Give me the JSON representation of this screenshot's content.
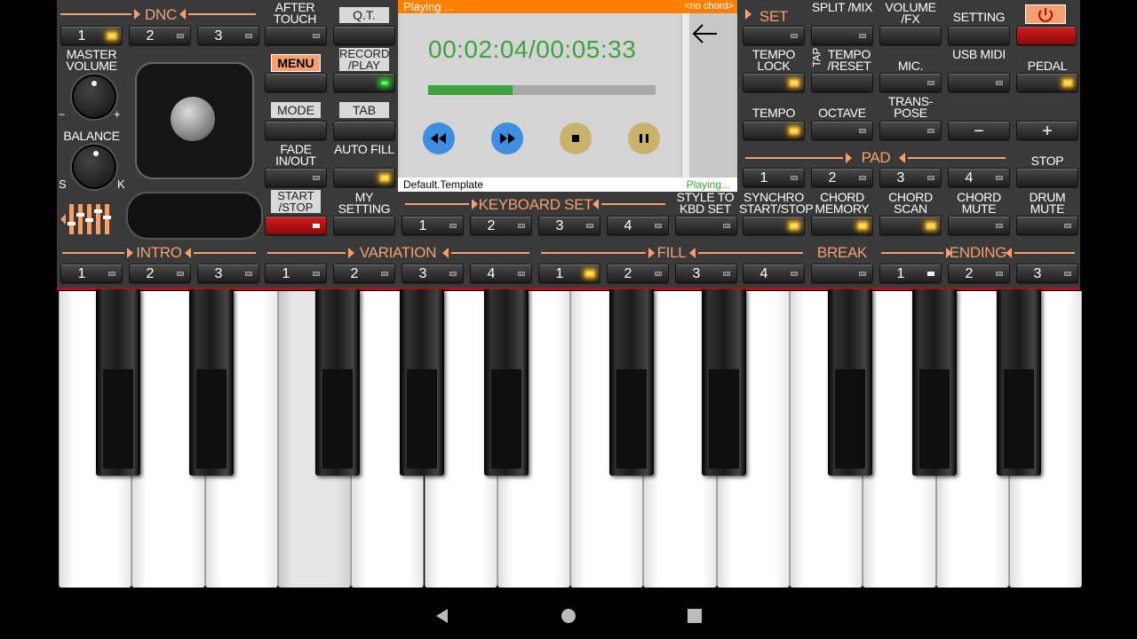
{
  "dnc": {
    "label": "DNC",
    "buttons": [
      "1",
      "2",
      "3"
    ]
  },
  "after_touch": "AFTER TOUCH",
  "qt": "Q.T.",
  "menu": "MENU",
  "record_play": "RECORD /PLAY",
  "mode": "MODE",
  "tab": "TAB",
  "fade": "FADE IN/OUT",
  "auto_fill": "AUTO FILL",
  "start_stop": "START /STOP",
  "my_setting": "MY SETTING",
  "master_volume": "MASTER VOLUME",
  "balance": "BALANCE",
  "knob_minus": "–",
  "knob_plus": "+",
  "knob_s": "S",
  "knob_k": "K",
  "player": {
    "status": "Playing ...",
    "chord": "<no chord>",
    "time": "00:02:04/00:05:33",
    "progress": 0.37,
    "template": "Default.Template",
    "status2": "Playing..."
  },
  "keyboard_set": {
    "label": "KEYBOARD SET",
    "buttons": [
      "1",
      "2",
      "3",
      "4"
    ]
  },
  "style_to_kbd": "STYLE TO KBD SET",
  "right": {
    "set": "SET",
    "split_mix": "SPLIT /MIX",
    "volume_fx": "VOLUME /FX",
    "setting": "SETTING",
    "tempo_lock": "TEMPO LOCK",
    "tap": "TAP",
    "tempo_reset": "TEMPO /RESET",
    "mic": "MIC.",
    "usb_midi": "USB MIDI",
    "pedal": "PEDAL",
    "tempo": "TEMPO",
    "octave": "OCTAVE",
    "transpose": "TRANS- POSE",
    "minus": "−",
    "plus": "+",
    "pad": "PAD",
    "pad_buttons": [
      "1",
      "2",
      "3",
      "4"
    ],
    "stop": "STOP",
    "synchro": "SYNCHRO START/STOP",
    "chord_memory": "CHORD MEMORY",
    "chord_scan": "CHORD SCAN",
    "chord_mute": "CHORD MUTE",
    "drum_mute": "DRUM MUTE"
  },
  "bottom": {
    "intro": {
      "label": "INTRO",
      "buttons": [
        "1",
        "2",
        "3"
      ]
    },
    "variation": {
      "label": "VARIATION",
      "buttons": [
        "1",
        "2",
        "3",
        "4"
      ]
    },
    "fill": {
      "label": "FILL",
      "buttons": [
        "1",
        "2",
        "3",
        "4"
      ]
    },
    "break": "BREAK",
    "ending": {
      "label": "ENDING",
      "buttons": [
        "1",
        "2",
        "3"
      ]
    }
  },
  "colors": {
    "accent": "#f5a06e",
    "panel": "#3a3a3a",
    "progress": "#3ea33e",
    "player_bar": "#ff7f00"
  },
  "navbar": {
    "icons": [
      "back-icon",
      "home-icon",
      "recents-icon"
    ]
  }
}
